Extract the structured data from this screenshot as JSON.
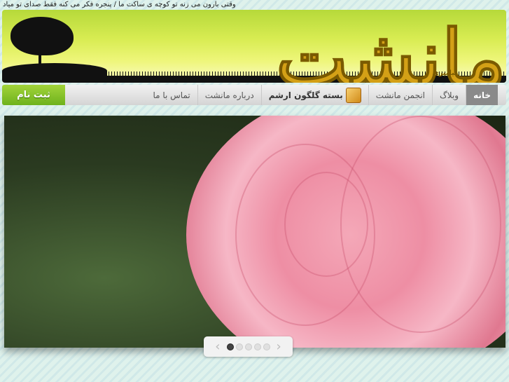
{
  "tagline": "وقتی بارون می زنه تو کوچه ی ساکت ما / پنجره فکر می کنه فقط صدای تو میاد",
  "logo": {
    "title": "مانشت",
    "subtitle": "بیلبیزی"
  },
  "nav": {
    "items": [
      {
        "label": "خانه",
        "active": true
      },
      {
        "label": "وبلاگ"
      },
      {
        "label": "انجمن مانشت"
      },
      {
        "label": "بسته گلگون ارشم",
        "icon": "gift-box-icon"
      },
      {
        "label": "درباره مانشت"
      },
      {
        "label": "تماس با ما"
      }
    ],
    "register": "ثبت نام"
  },
  "slider": {
    "prev": "‹",
    "next": "›",
    "slide_count": 5,
    "current": 1
  }
}
